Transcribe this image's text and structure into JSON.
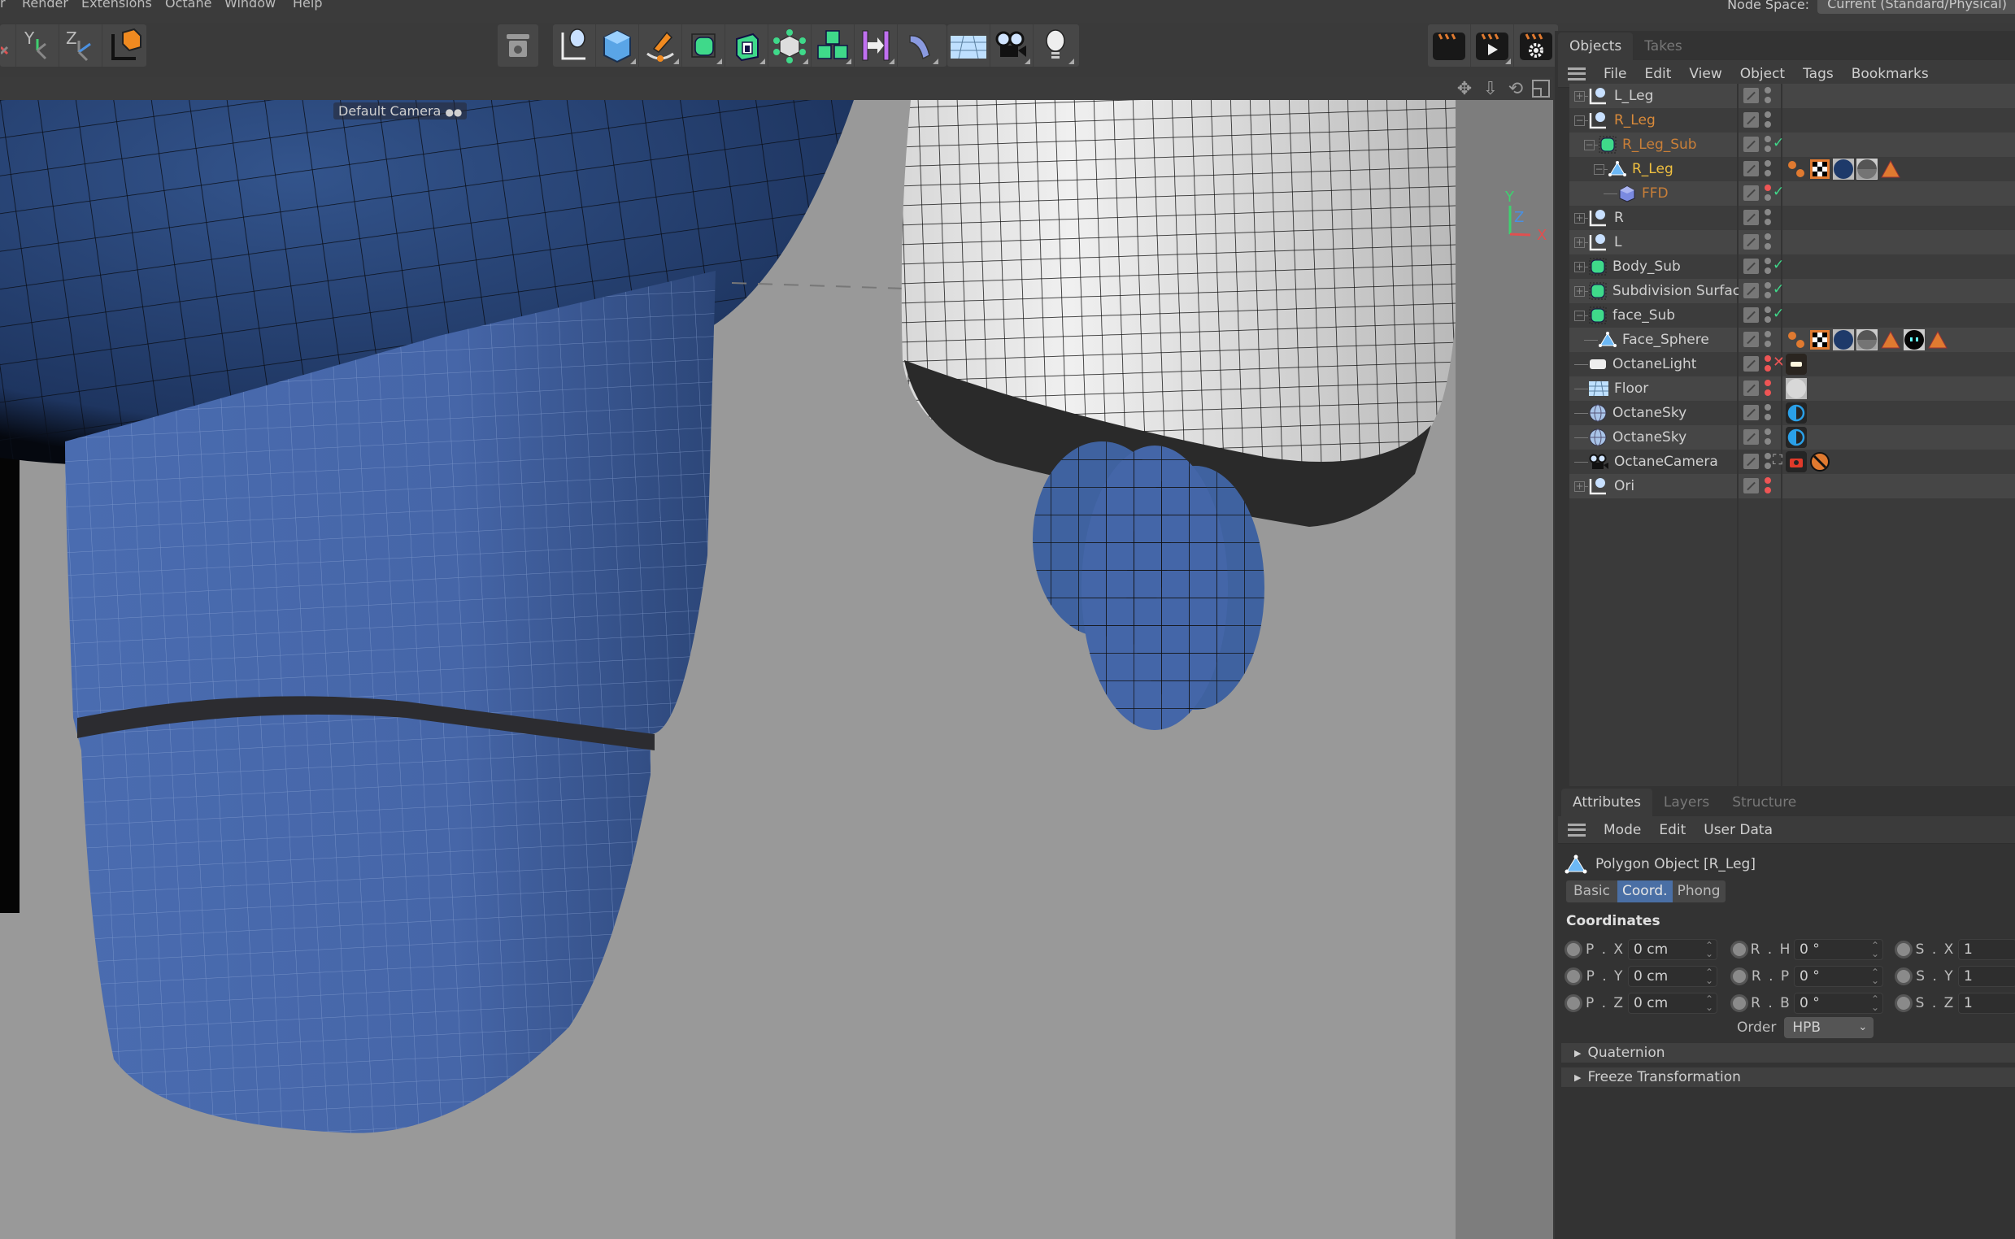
{
  "menubar": {
    "items": [
      "r",
      "Render",
      "Extensions",
      "Octane",
      "Window",
      "Help"
    ],
    "node_space_label": "Node Space:",
    "node_space_value": "Current (Standard/Physical)"
  },
  "toolbar": {
    "axis_buttons": [
      {
        "name": "x-axis-lock",
        "label": "X"
      },
      {
        "name": "y-axis-lock",
        "label": "Y"
      },
      {
        "name": "z-axis-lock",
        "label": "Z"
      },
      {
        "name": "coordinate-system",
        "label": ""
      }
    ],
    "tools": [
      "render-region",
      "null-object",
      "cube",
      "pen-spline",
      "subdivision-surface",
      "extrude",
      "polygon-object-deformer",
      "cloner",
      "symmetry",
      "bend-deformer",
      "floor",
      "camera",
      "light"
    ],
    "render_buttons": [
      "render-view",
      "render-to-picture-viewer",
      "render-settings"
    ]
  },
  "viewport": {
    "camera_label": "Default Camera",
    "axis_labels": {
      "y": "Y",
      "z": "Z",
      "x": "X"
    }
  },
  "objects_panel": {
    "tabs": [
      {
        "label": "Objects",
        "active": true
      },
      {
        "label": "Takes",
        "active": false
      }
    ],
    "menu": [
      "File",
      "Edit",
      "View",
      "Object",
      "Tags",
      "Bookmarks"
    ],
    "rows": [
      {
        "name": "L_Leg",
        "indent": 0,
        "expander": "+",
        "icon": "null",
        "color": "#cfcfcf",
        "dots": [
          "grey",
          "grey"
        ],
        "check": "",
        "tags": []
      },
      {
        "name": "R_Leg",
        "indent": 0,
        "expander": "-",
        "icon": "null",
        "color": "#d98a3a",
        "dots": [
          "grey",
          "grey"
        ],
        "check": "",
        "tags": []
      },
      {
        "name": "R_Leg_Sub",
        "indent": 1,
        "expander": "-",
        "icon": "subdiv",
        "color": "#c97f38",
        "dots": [
          "grey",
          "grey"
        ],
        "check": "check",
        "tags": []
      },
      {
        "name": "R_Leg",
        "indent": 2,
        "expander": "-",
        "icon": "polygon",
        "color": "#f0c040",
        "dots": [
          "grey",
          "grey"
        ],
        "check": "",
        "tags": [
          "phong",
          "uvw",
          "material-blue",
          "material-chrome",
          "warning"
        ]
      },
      {
        "name": "FFD",
        "indent": 3,
        "expander": "",
        "icon": "ffd",
        "color": "#c97f38",
        "dots": [
          "red",
          "grey"
        ],
        "check": "check",
        "tags": []
      },
      {
        "name": "R",
        "indent": 0,
        "expander": "+",
        "icon": "null",
        "color": "#cfcfcf",
        "dots": [
          "grey",
          "grey"
        ],
        "check": "",
        "tags": []
      },
      {
        "name": "L",
        "indent": 0,
        "expander": "+",
        "icon": "null",
        "color": "#cfcfcf",
        "dots": [
          "grey",
          "grey"
        ],
        "check": "",
        "tags": []
      },
      {
        "name": "Body_Sub",
        "indent": 0,
        "expander": "+",
        "icon": "subdiv",
        "color": "#cfcfcf",
        "dots": [
          "grey",
          "grey"
        ],
        "check": "check",
        "tags": []
      },
      {
        "name": "Subdivision Surface",
        "indent": 0,
        "expander": "+",
        "icon": "subdiv",
        "color": "#cfcfcf",
        "dots": [
          "grey",
          "grey"
        ],
        "check": "check",
        "tags": []
      },
      {
        "name": "face_Sub",
        "indent": 0,
        "expander": "-",
        "icon": "subdiv",
        "color": "#cfcfcf",
        "dots": [
          "grey",
          "grey"
        ],
        "check": "check",
        "tags": []
      },
      {
        "name": "Face_Sphere",
        "indent": 1,
        "expander": "",
        "icon": "polygon",
        "color": "#cfcfcf",
        "dots": [
          "grey",
          "grey"
        ],
        "check": "",
        "tags": [
          "phong",
          "uvw",
          "material-blue",
          "material-chrome",
          "warning",
          "material-face",
          "warning"
        ]
      },
      {
        "name": "OctaneLight",
        "indent": 0,
        "expander": "",
        "icon": "light",
        "color": "#cfcfcf",
        "dots": [
          "red",
          "red"
        ],
        "check": "x",
        "tags": [
          "octane-light-tag"
        ]
      },
      {
        "name": "Floor",
        "indent": 0,
        "expander": "",
        "icon": "floor",
        "color": "#cfcfcf",
        "dots": [
          "red",
          "red"
        ],
        "check": "",
        "tags": [
          "material-grey"
        ]
      },
      {
        "name": "OctaneSky",
        "indent": 0,
        "expander": "",
        "icon": "sky",
        "color": "#cfcfcf",
        "dots": [
          "grey",
          "grey"
        ],
        "check": "",
        "tags": [
          "octane-environment"
        ]
      },
      {
        "name": "OctaneSky",
        "indent": 0,
        "expander": "",
        "icon": "sky",
        "color": "#cfcfcf",
        "dots": [
          "grey",
          "grey"
        ],
        "check": "",
        "tags": [
          "octane-environment"
        ]
      },
      {
        "name": "OctaneCamera",
        "indent": 0,
        "expander": "",
        "icon": "camera",
        "color": "#cfcfcf",
        "dots": [
          "grey",
          "grey"
        ],
        "check": "frame",
        "tags": [
          "octane-camera-tag",
          "protection-tag"
        ]
      },
      {
        "name": "Ori",
        "indent": 0,
        "expander": "+",
        "icon": "null",
        "color": "#cfcfcf",
        "dots": [
          "red",
          "red"
        ],
        "check": "",
        "tags": []
      }
    ]
  },
  "attributes_panel": {
    "tabs": [
      {
        "label": "Attributes",
        "active": true
      },
      {
        "label": "Layers",
        "active": false
      },
      {
        "label": "Structure",
        "active": false
      }
    ],
    "menu": [
      "Mode",
      "Edit",
      "User Data"
    ],
    "object_title": "Polygon Object [R_Leg]",
    "subtabs": [
      {
        "label": "Basic",
        "active": false
      },
      {
        "label": "Coord.",
        "active": true
      },
      {
        "label": "Phong",
        "active": false
      }
    ],
    "section_title": "Coordinates",
    "position": [
      {
        "label": "P . X",
        "value": "0 cm"
      },
      {
        "label": "P . Y",
        "value": "0 cm"
      },
      {
        "label": "P . Z",
        "value": "0 cm"
      }
    ],
    "rotation": [
      {
        "label": "R . H",
        "value": "0 °"
      },
      {
        "label": "R . P",
        "value": "0 °"
      },
      {
        "label": "R . B",
        "value": "0 °"
      }
    ],
    "scale": [
      {
        "label": "S . X",
        "value": "1"
      },
      {
        "label": "S . Y",
        "value": "1"
      },
      {
        "label": "S . Z",
        "value": "1"
      }
    ],
    "order_label": "Order",
    "order_value": "HPB",
    "collapsed_sections": [
      "Quaternion",
      "Freeze Transformation"
    ]
  },
  "colors": {
    "accent_active_tab": "#4a6fa5",
    "selected_object": "#f0c040",
    "child_selected": "#c97f38",
    "check_green": "#3fd98a",
    "red_dot": "#e55555",
    "model_blue": "#3f62a0"
  }
}
